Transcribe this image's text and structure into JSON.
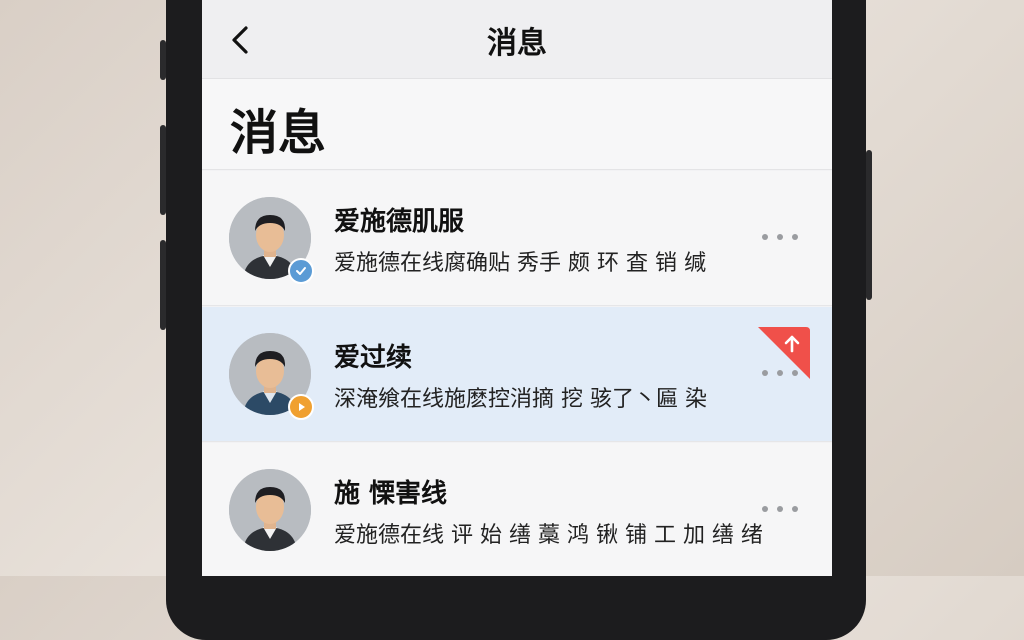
{
  "nav": {
    "title": "消息",
    "back_icon": "chevron-left-icon"
  },
  "header": {
    "title": "消息"
  },
  "messages": [
    {
      "name": "爱施德肌服",
      "preview": "爱施德在线腐确贴 秀手 颇 环 査 销 缄",
      "badge_color": "#5b9bd5",
      "badge_icon": "check-icon",
      "pinned": false
    },
    {
      "name": "爱过续",
      "preview": "深淹飨在线施麽控消摘 挖 骇了丶匾 染",
      "badge_color": "#f0a030",
      "badge_icon": "play-icon",
      "pinned": true,
      "pin_color": "#f0504a",
      "pin_icon": "arrow-up-icon"
    },
    {
      "name": "施 慄害线",
      "preview": "爱施德在线 评 始 缮 藁 鸿 锹 铺 工 加 缮 绪",
      "badge_color": null,
      "pinned": false
    }
  ],
  "colors": {
    "highlight_row": "#e2ecf8",
    "more_dots": "#9a9ca0"
  },
  "more_icon": "more-horizontal-icon"
}
